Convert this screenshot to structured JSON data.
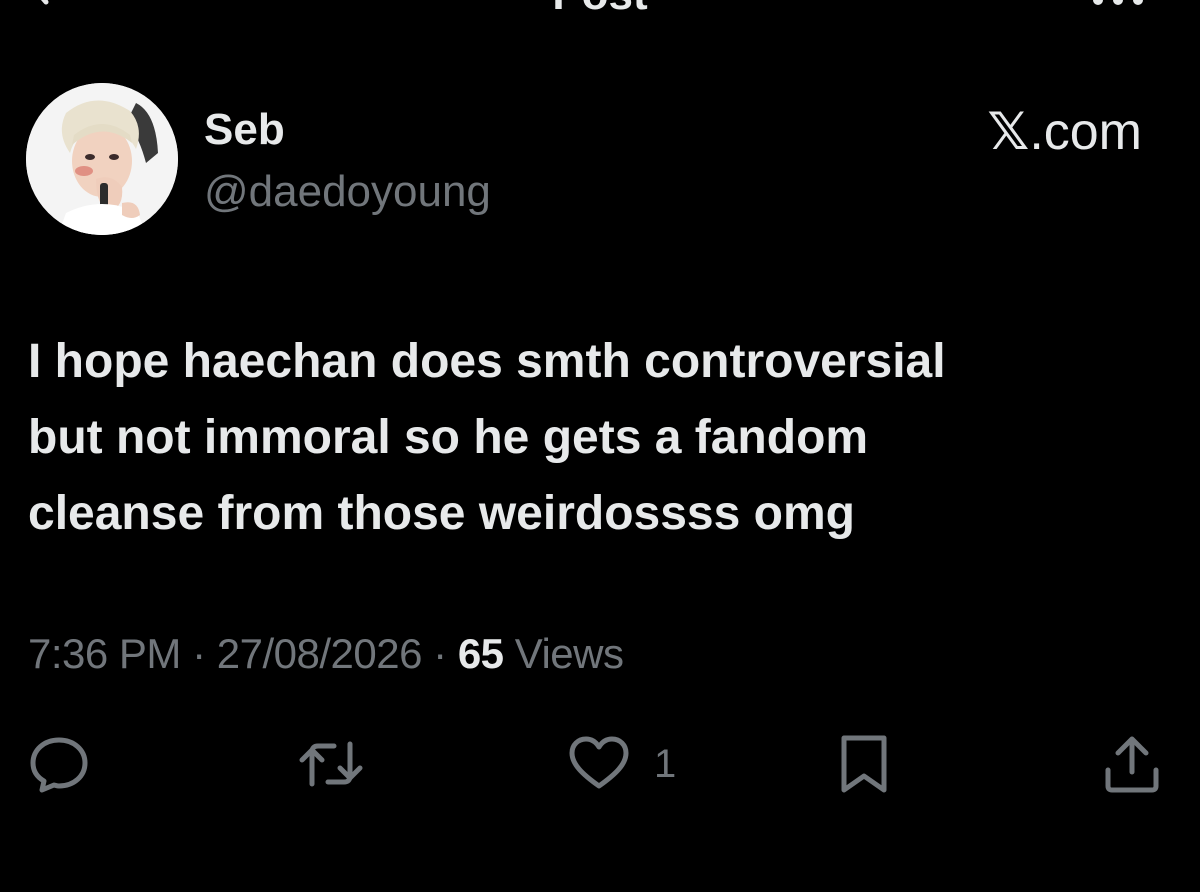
{
  "topbar": {
    "title": "Post"
  },
  "author": {
    "name": "Seb",
    "handle": "@daedoyoung"
  },
  "brand": {
    "text": ".com"
  },
  "post": {
    "lines": [
      "I hope haechan does smth controversial",
      "but not immoral so he gets a fandom",
      "cleanse from those weirdossss omg"
    ]
  },
  "meta": {
    "time": "7:36 PM",
    "separator": "·",
    "date": "27/08/2026",
    "views_count": "65",
    "views_label": "Views"
  },
  "actions": {
    "reply_icon": "speech-bubble",
    "repost_icon": "repost-arrows",
    "like_icon": "heart",
    "like_count": "1",
    "bookmark_icon": "bookmark",
    "share_icon": "share-up-arrow"
  },
  "colors": {
    "background": "#000000",
    "primary_text": "#e7e9ea",
    "secondary_text": "#71767b"
  }
}
